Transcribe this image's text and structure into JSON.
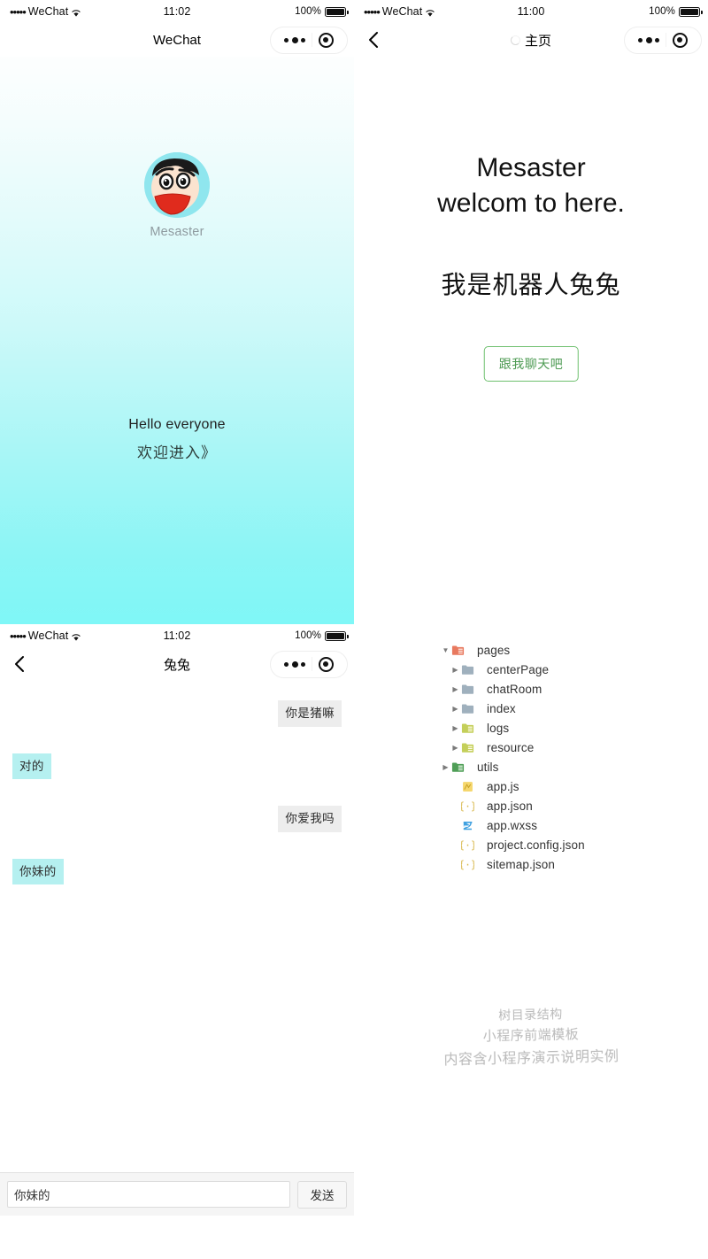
{
  "colors": {
    "accent_cyan": "#b5f0f0",
    "bubble_me": "#ededed",
    "button_green": "#6fc06f",
    "button_green_text": "#4c9a52",
    "gradient_top": "#fdfefe",
    "gradient_bottom": "#7ff7f7"
  },
  "panels": {
    "welcome": {
      "status": {
        "carrier": "WeChat",
        "dots": "•••••",
        "time": "11:02",
        "battery_pct": "100%"
      },
      "nav": {
        "title": "WeChat",
        "back_icon": "",
        "capsule_more_icon": "more-dots-icon",
        "capsule_target_icon": "target-circle-icon"
      },
      "avatar_name": "Mesaster",
      "avatar_icon": "shinchan-avatar",
      "welcome_en": "Hello everyone",
      "welcome_cn": "欢迎进入》"
    },
    "home": {
      "status": {
        "carrier": "WeChat",
        "dots": "•••••",
        "time": "11:00",
        "battery_pct": "100%"
      },
      "nav": {
        "title": "主页",
        "back_icon": "chevron-left-icon",
        "spinner_icon": "loading-spinner-icon"
      },
      "title_line1": "Mesaster",
      "title_line2": "welcom to here.",
      "subtitle": "我是机器人兔兔",
      "chat_button": "跟我聊天吧"
    },
    "chatroom": {
      "status": {
        "carrier": "WeChat",
        "dots": "•••••",
        "time": "11:02",
        "battery_pct": "100%"
      },
      "nav": {
        "title": "兔兔",
        "back_icon": "chevron-left-icon"
      },
      "messages": [
        {
          "side": "right",
          "text": "你是猪嘛"
        },
        {
          "side": "left",
          "text": "对的"
        },
        {
          "side": "right",
          "text": "你爱我吗"
        },
        {
          "side": "left",
          "text": "你妹的"
        }
      ],
      "input_value": "你妹的",
      "input_placeholder": "",
      "send_label": "发送"
    },
    "filetree": {
      "nodes": [
        {
          "label": "pages",
          "indent": 1,
          "twisty": "open",
          "icon": "folder-red",
          "kind": "folder"
        },
        {
          "label": "centerPage",
          "indent": 2,
          "twisty": "closed",
          "icon": "folder-blue",
          "kind": "folder"
        },
        {
          "label": "chatRoom",
          "indent": 2,
          "twisty": "closed",
          "icon": "folder-blue",
          "kind": "folder"
        },
        {
          "label": "index",
          "indent": 2,
          "twisty": "closed",
          "icon": "folder-blue",
          "kind": "folder"
        },
        {
          "label": "logs",
          "indent": 2,
          "twisty": "closed",
          "icon": "folder-yellow",
          "kind": "folder"
        },
        {
          "label": "resource",
          "indent": 2,
          "twisty": "closed",
          "icon": "folder-yellow",
          "kind": "folder"
        },
        {
          "label": "utils",
          "indent": 1,
          "twisty": "closed",
          "icon": "folder-green",
          "kind": "folder"
        },
        {
          "label": "app.js",
          "indent": 2,
          "twisty": "none",
          "icon": "js-file",
          "kind": "file"
        },
        {
          "label": "app.json",
          "indent": 2,
          "twisty": "none",
          "icon": "json-file",
          "kind": "file"
        },
        {
          "label": "app.wxss",
          "indent": 2,
          "twisty": "none",
          "icon": "wxss-file",
          "kind": "file"
        },
        {
          "label": "project.config.json",
          "indent": 2,
          "twisty": "none",
          "icon": "json-file",
          "kind": "file"
        },
        {
          "label": "sitemap.json",
          "indent": 2,
          "twisty": "none",
          "icon": "json-file",
          "kind": "file"
        }
      ],
      "watermark": [
        "树目录结构",
        "小程序前端模板",
        "内容含小程序演示说明实例"
      ]
    }
  }
}
